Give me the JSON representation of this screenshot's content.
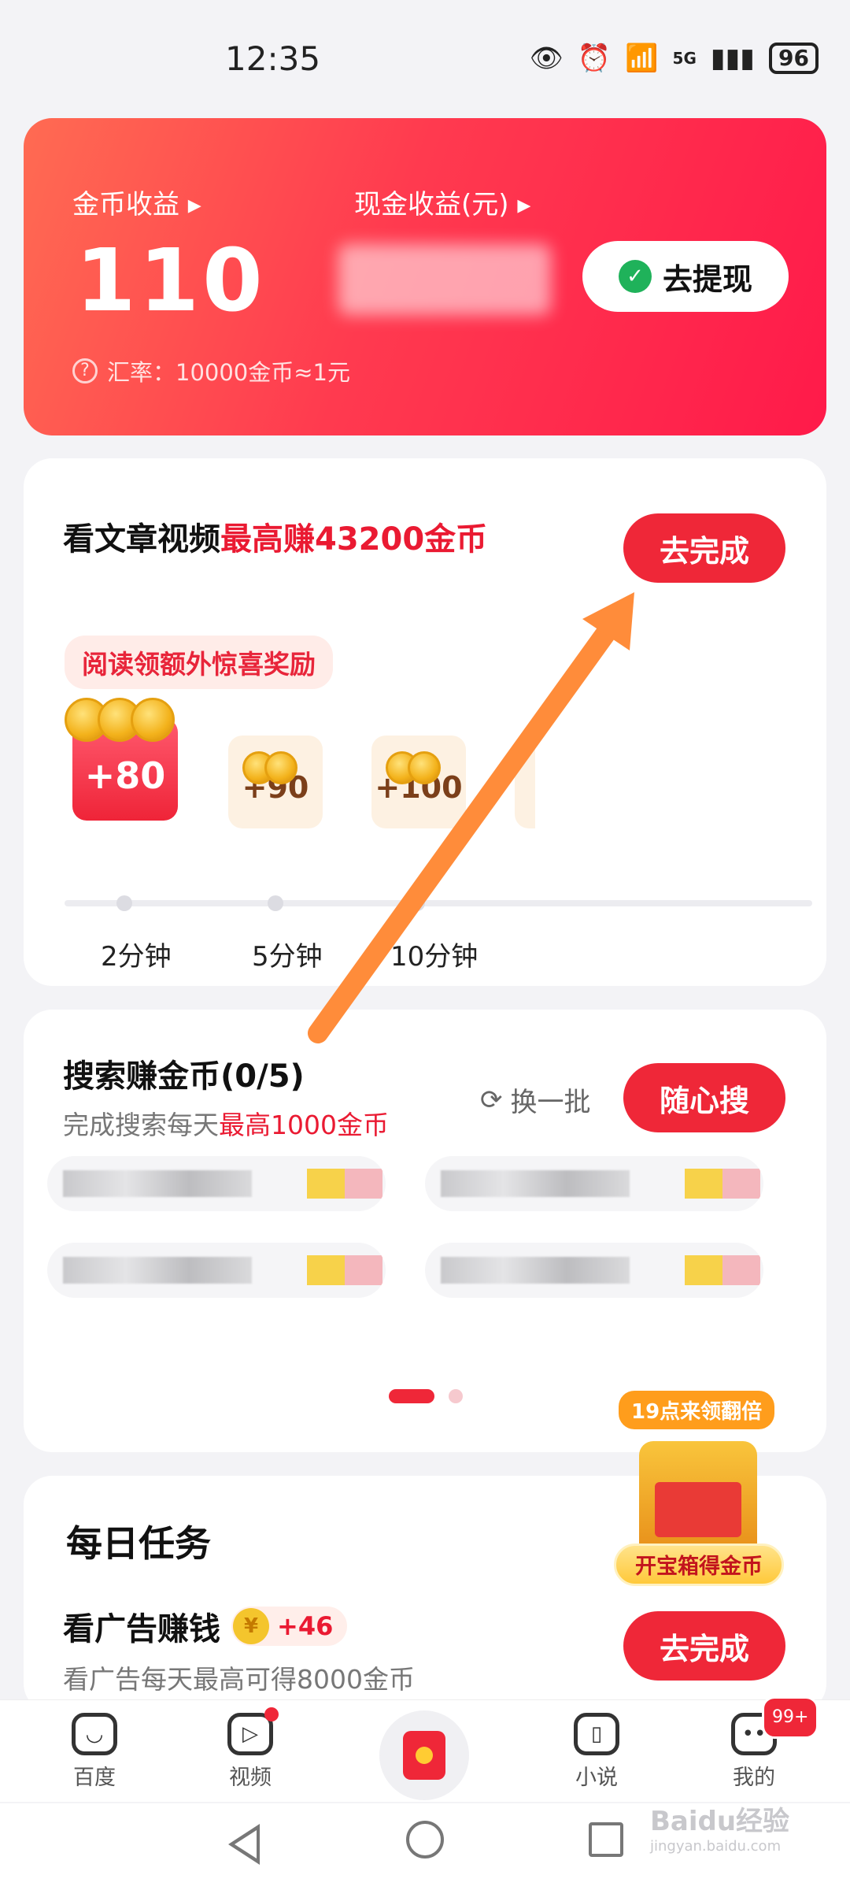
{
  "status_bar": {
    "time": "12:35",
    "battery": "96",
    "network": "5G"
  },
  "earnings": {
    "coin_label": "金币收益",
    "coin_value": "110",
    "cash_label": "现金收益(元)",
    "rate_text": "汇率：10000金币≈1元",
    "withdraw_label": "去提现"
  },
  "article_task": {
    "title_prefix": "看文章视频",
    "title_highlight": "最高赚43200金币",
    "button_label": "去完成",
    "tag": "阅读领额外惊喜奖励",
    "rewards": [
      {
        "amount": "+80",
        "time": "2分钟",
        "active": true
      },
      {
        "amount": "+90",
        "time": "5分钟",
        "active": false
      },
      {
        "amount": "+100",
        "time": "10分钟",
        "active": false
      }
    ]
  },
  "search_task": {
    "title": "搜索赚金币(0/5)",
    "subtitle_prefix": "完成搜索每天",
    "subtitle_highlight": "最高1000金币",
    "refresh_label": "换一批",
    "button_label": "随心搜"
  },
  "daily_task": {
    "title": "每日任务",
    "task_title": "看广告赚钱",
    "task_reward": "+46",
    "task_desc": "看广告每天最高可得8000金币",
    "button_label": "去完成"
  },
  "treasure": {
    "badge": "19点来领翻倍",
    "caption": "开宝箱得金币"
  },
  "bottom_nav": [
    {
      "label": "百度"
    },
    {
      "label": "视频"
    },
    {
      "label": "小说"
    },
    {
      "label": "我的",
      "badge": "99+"
    }
  ],
  "watermark": {
    "brand": "Baidu经验",
    "url": "jingyan.baidu.com"
  },
  "colors": {
    "accent": "#ef2738",
    "highlight": "#ea1a32",
    "arrow": "#ff8c3a"
  }
}
